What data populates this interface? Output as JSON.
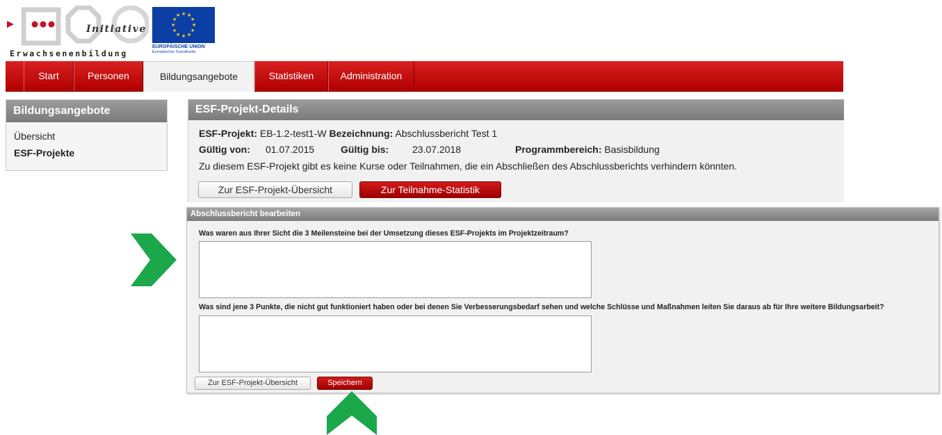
{
  "logos": {
    "initiative_word": "Initiative",
    "erwachsenenbildung_word": "Erwachsenenbildung",
    "eu_line1": "EUROPÄISCHE UNION",
    "eu_line2": "Europäischer Sozialfonds"
  },
  "nav": {
    "tabs": [
      "Start",
      "Personen",
      "Bildungsangebote",
      "Statistiken",
      "Administration"
    ],
    "active": "Bildungsangebote"
  },
  "sidebar": {
    "title": "Bildungsangebote",
    "items": [
      "Übersicht",
      "ESF-Projekte"
    ],
    "current": "ESF-Projekte"
  },
  "details": {
    "title": "ESF-Projekt-Details",
    "projekt_label": "ESF-Projekt:",
    "projekt_value": "EB-1.2-test1-W",
    "bezeichnung_label": "Bezeichnung:",
    "bezeichnung_value": "Abschlussbericht Test 1",
    "gueltig_von_label": "Gültig von:",
    "gueltig_von_value": "01.07.2015",
    "gueltig_bis_label": "Gültig bis:",
    "gueltig_bis_value": "23.07.2018",
    "programmbereich_label": "Programmbereich:",
    "programmbereich_value": "Basisbildung",
    "notice": "Zu diesem ESF-Projekt gibt es keine Kurse oder Teilnahmen, die ein Abschließen des Abschlussberichts verhindern könnten.",
    "btn_overview": "Zur ESF-Projekt-Übersicht",
    "btn_stats": "Zur Teilnahme-Statistik"
  },
  "report": {
    "title": "Abschlussbericht bearbeiten",
    "question1": "Was waren aus Ihrer Sicht die 3 Meilensteine bei der Umsetzung dieses ESF-Projekts im Projektzeitraum?",
    "answer1": "",
    "question2": "Was sind jene 3 Punkte, die nicht gut funktioniert haben oder bei denen Sie Verbesserungsbedarf sehen und welche Schlüsse und Maßnahmen leiten Sie daraus ab für Ihre weitere Bildungsarbeit?",
    "answer2": "",
    "btn_overview": "Zur ESF-Projekt-Übersicht",
    "btn_save": "Speichern"
  },
  "colors": {
    "nav_red": "#c81414",
    "panel_header_grey": "#8a8a8a",
    "arrow_green": "#1aa84a",
    "eu_blue": "#0b3fa6"
  },
  "icons": [
    "arrow-right-icon",
    "arrow-up-icon",
    "eu-stars-icon"
  ]
}
